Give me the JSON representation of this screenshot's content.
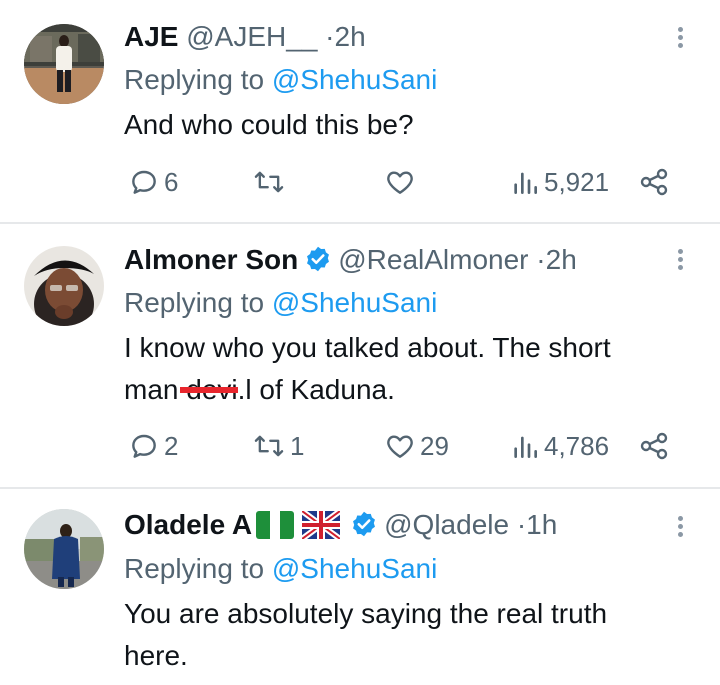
{
  "tweets": [
    {
      "display_name": "AJE",
      "handle": "@AJEH__",
      "separator": "·",
      "time": "2h",
      "replying_prefix": "Replying to",
      "replying_to": "@ShehuSani",
      "text": "And who could this be?",
      "replies": "6",
      "retweets": "",
      "likes": "",
      "views": "5,921",
      "verified": false
    },
    {
      "display_name": "Almoner Son",
      "handle": "@RealAlmoner",
      "separator": "·",
      "time": "2h",
      "replying_prefix": "Replying to",
      "replying_to": "@ShehuSani",
      "text_line1": "I know who you talked about. The short",
      "text_line2_a": "man d",
      "text_line2_b": "e",
      "text_line2_c": "v",
      "text_line2_d": "i",
      "text_line2_e": ".l of Kaduna.",
      "replies": "2",
      "retweets": "1",
      "likes": "29",
      "views": "4,786",
      "verified": true
    },
    {
      "display_name": "Oladele A",
      "handle": "@Qladele",
      "separator": "·",
      "time": "1h",
      "replying_prefix": "Replying to",
      "replying_to": "@ShehuSani",
      "text_line1": "You are absolutely saying the real truth",
      "text_line2": "here.",
      "verified": true,
      "flags": [
        "nigeria-flag",
        "uk-flag"
      ]
    }
  ],
  "colors": {
    "text": "#0f1419",
    "muted": "#536471",
    "link": "#1d9bf0",
    "verified": "#1d9bf0",
    "divider": "#e6e8ea",
    "redaction": "#e8262d"
  },
  "icons": [
    "reply-icon",
    "retweet-icon",
    "like-icon",
    "views-icon",
    "share-icon",
    "more-icon",
    "verified-badge-icon"
  ]
}
